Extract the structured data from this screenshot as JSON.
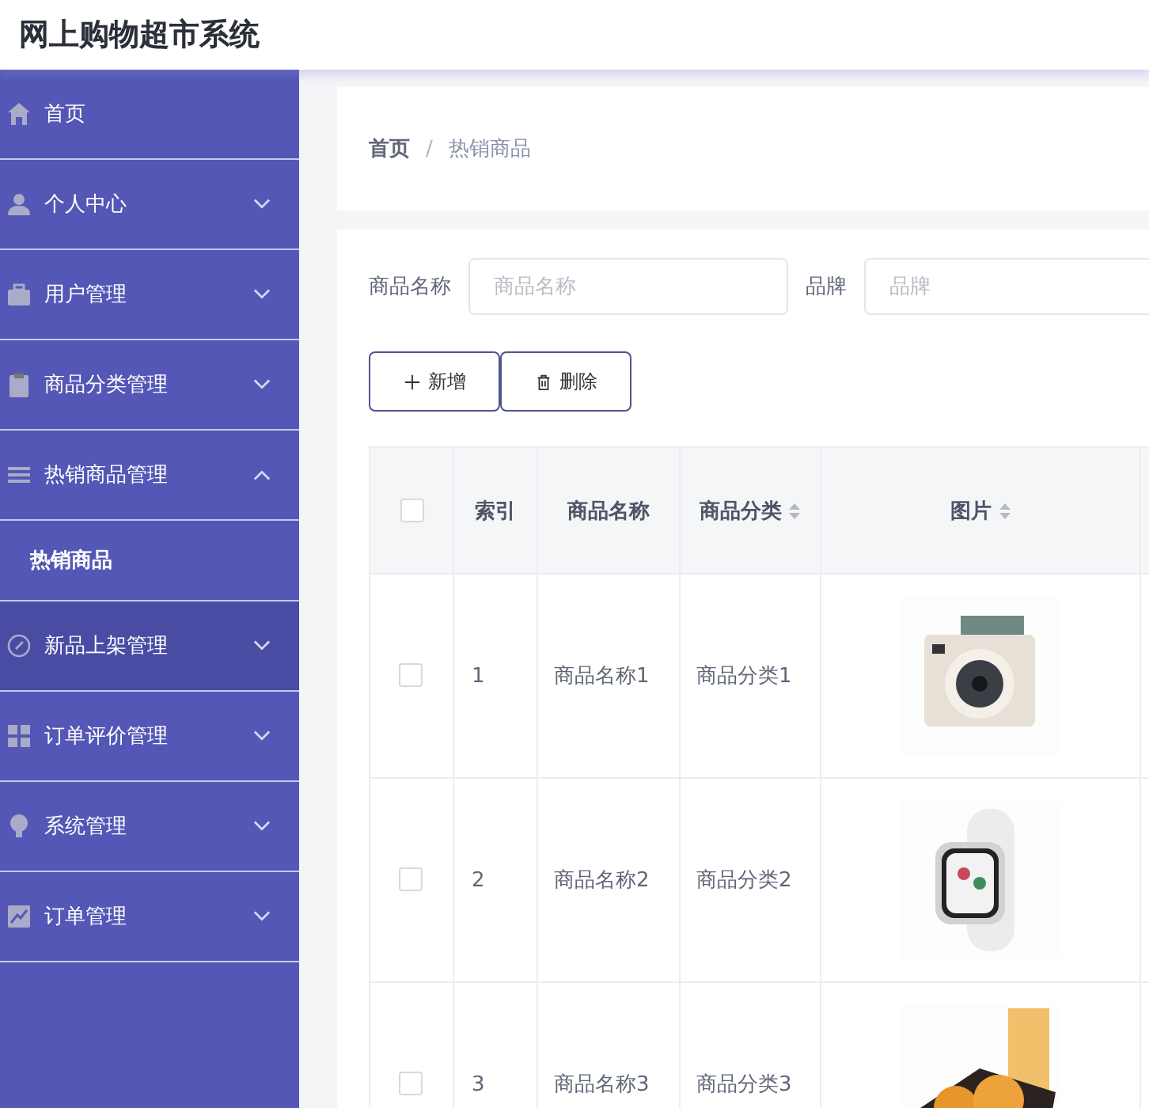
{
  "header": {
    "title": "网上购物超市系统"
  },
  "sidebar": {
    "items": [
      {
        "label": "首页",
        "highlighted": false
      },
      {
        "label": "个人中心",
        "expanded": false,
        "highlighted": false
      },
      {
        "label": "用户管理",
        "expanded": false,
        "highlighted": false
      },
      {
        "label": "商品分类管理",
        "expanded": false,
        "highlighted": false
      },
      {
        "label": "热销商品管理",
        "expanded": true,
        "highlighted": false,
        "children": [
          {
            "label": "热销商品"
          }
        ]
      },
      {
        "label": "新品上架管理",
        "expanded": false,
        "highlighted": true
      },
      {
        "label": "订单评价管理",
        "expanded": false,
        "highlighted": false
      },
      {
        "label": "系统管理",
        "expanded": false,
        "highlighted": false
      },
      {
        "label": "订单管理",
        "expanded": false,
        "highlighted": false
      }
    ]
  },
  "breadcrumb": {
    "separator": "/",
    "items": [
      {
        "label": "首页"
      },
      {
        "label": "热销商品"
      }
    ]
  },
  "search": [
    {
      "label": "商品名称",
      "placeholder": "商品名称"
    },
    {
      "label": "品牌",
      "placeholder": "品牌"
    }
  ],
  "actions": [
    {
      "kind": "add",
      "label": "新增"
    },
    {
      "kind": "delete",
      "label": "删除"
    }
  ],
  "table": {
    "header_checked": false,
    "columns": [
      {
        "label": "索引",
        "sortable": false
      },
      {
        "label": "商品名称",
        "sortable": false
      },
      {
        "label": "商品分类",
        "sortable": true
      },
      {
        "label": "图片",
        "sortable": true
      }
    ],
    "rows": [
      {
        "checked": false,
        "index": "1",
        "name": "商品名称1",
        "category": "商品分类1"
      },
      {
        "checked": false,
        "index": "2",
        "name": "商品名称2",
        "category": "商品分类2"
      },
      {
        "checked": false,
        "index": "3",
        "name": "商品名称3",
        "category": "商品分类3"
      }
    ]
  }
}
